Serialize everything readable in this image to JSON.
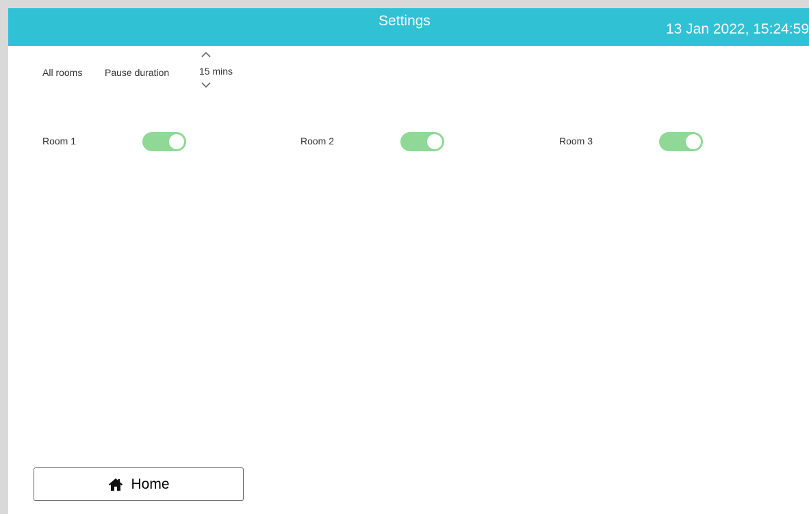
{
  "header": {
    "title": "Settings",
    "datetime": "13 Jan 2022, 15:24:59",
    "accent_color": "#30c1d4"
  },
  "pause": {
    "all_rooms_label": "All rooms",
    "duration_label": "Pause duration",
    "duration_value": "15 mins",
    "up_icon": "chevron-up-icon",
    "down_icon": "chevron-down-icon"
  },
  "rooms": [
    {
      "label": "Room 1",
      "enabled": true
    },
    {
      "label": "Room 2",
      "enabled": true
    },
    {
      "label": "Room 3",
      "enabled": true
    }
  ],
  "toggle_on_color": "#8fd895",
  "footer": {
    "home_label": "Home",
    "home_icon": "home-icon"
  }
}
